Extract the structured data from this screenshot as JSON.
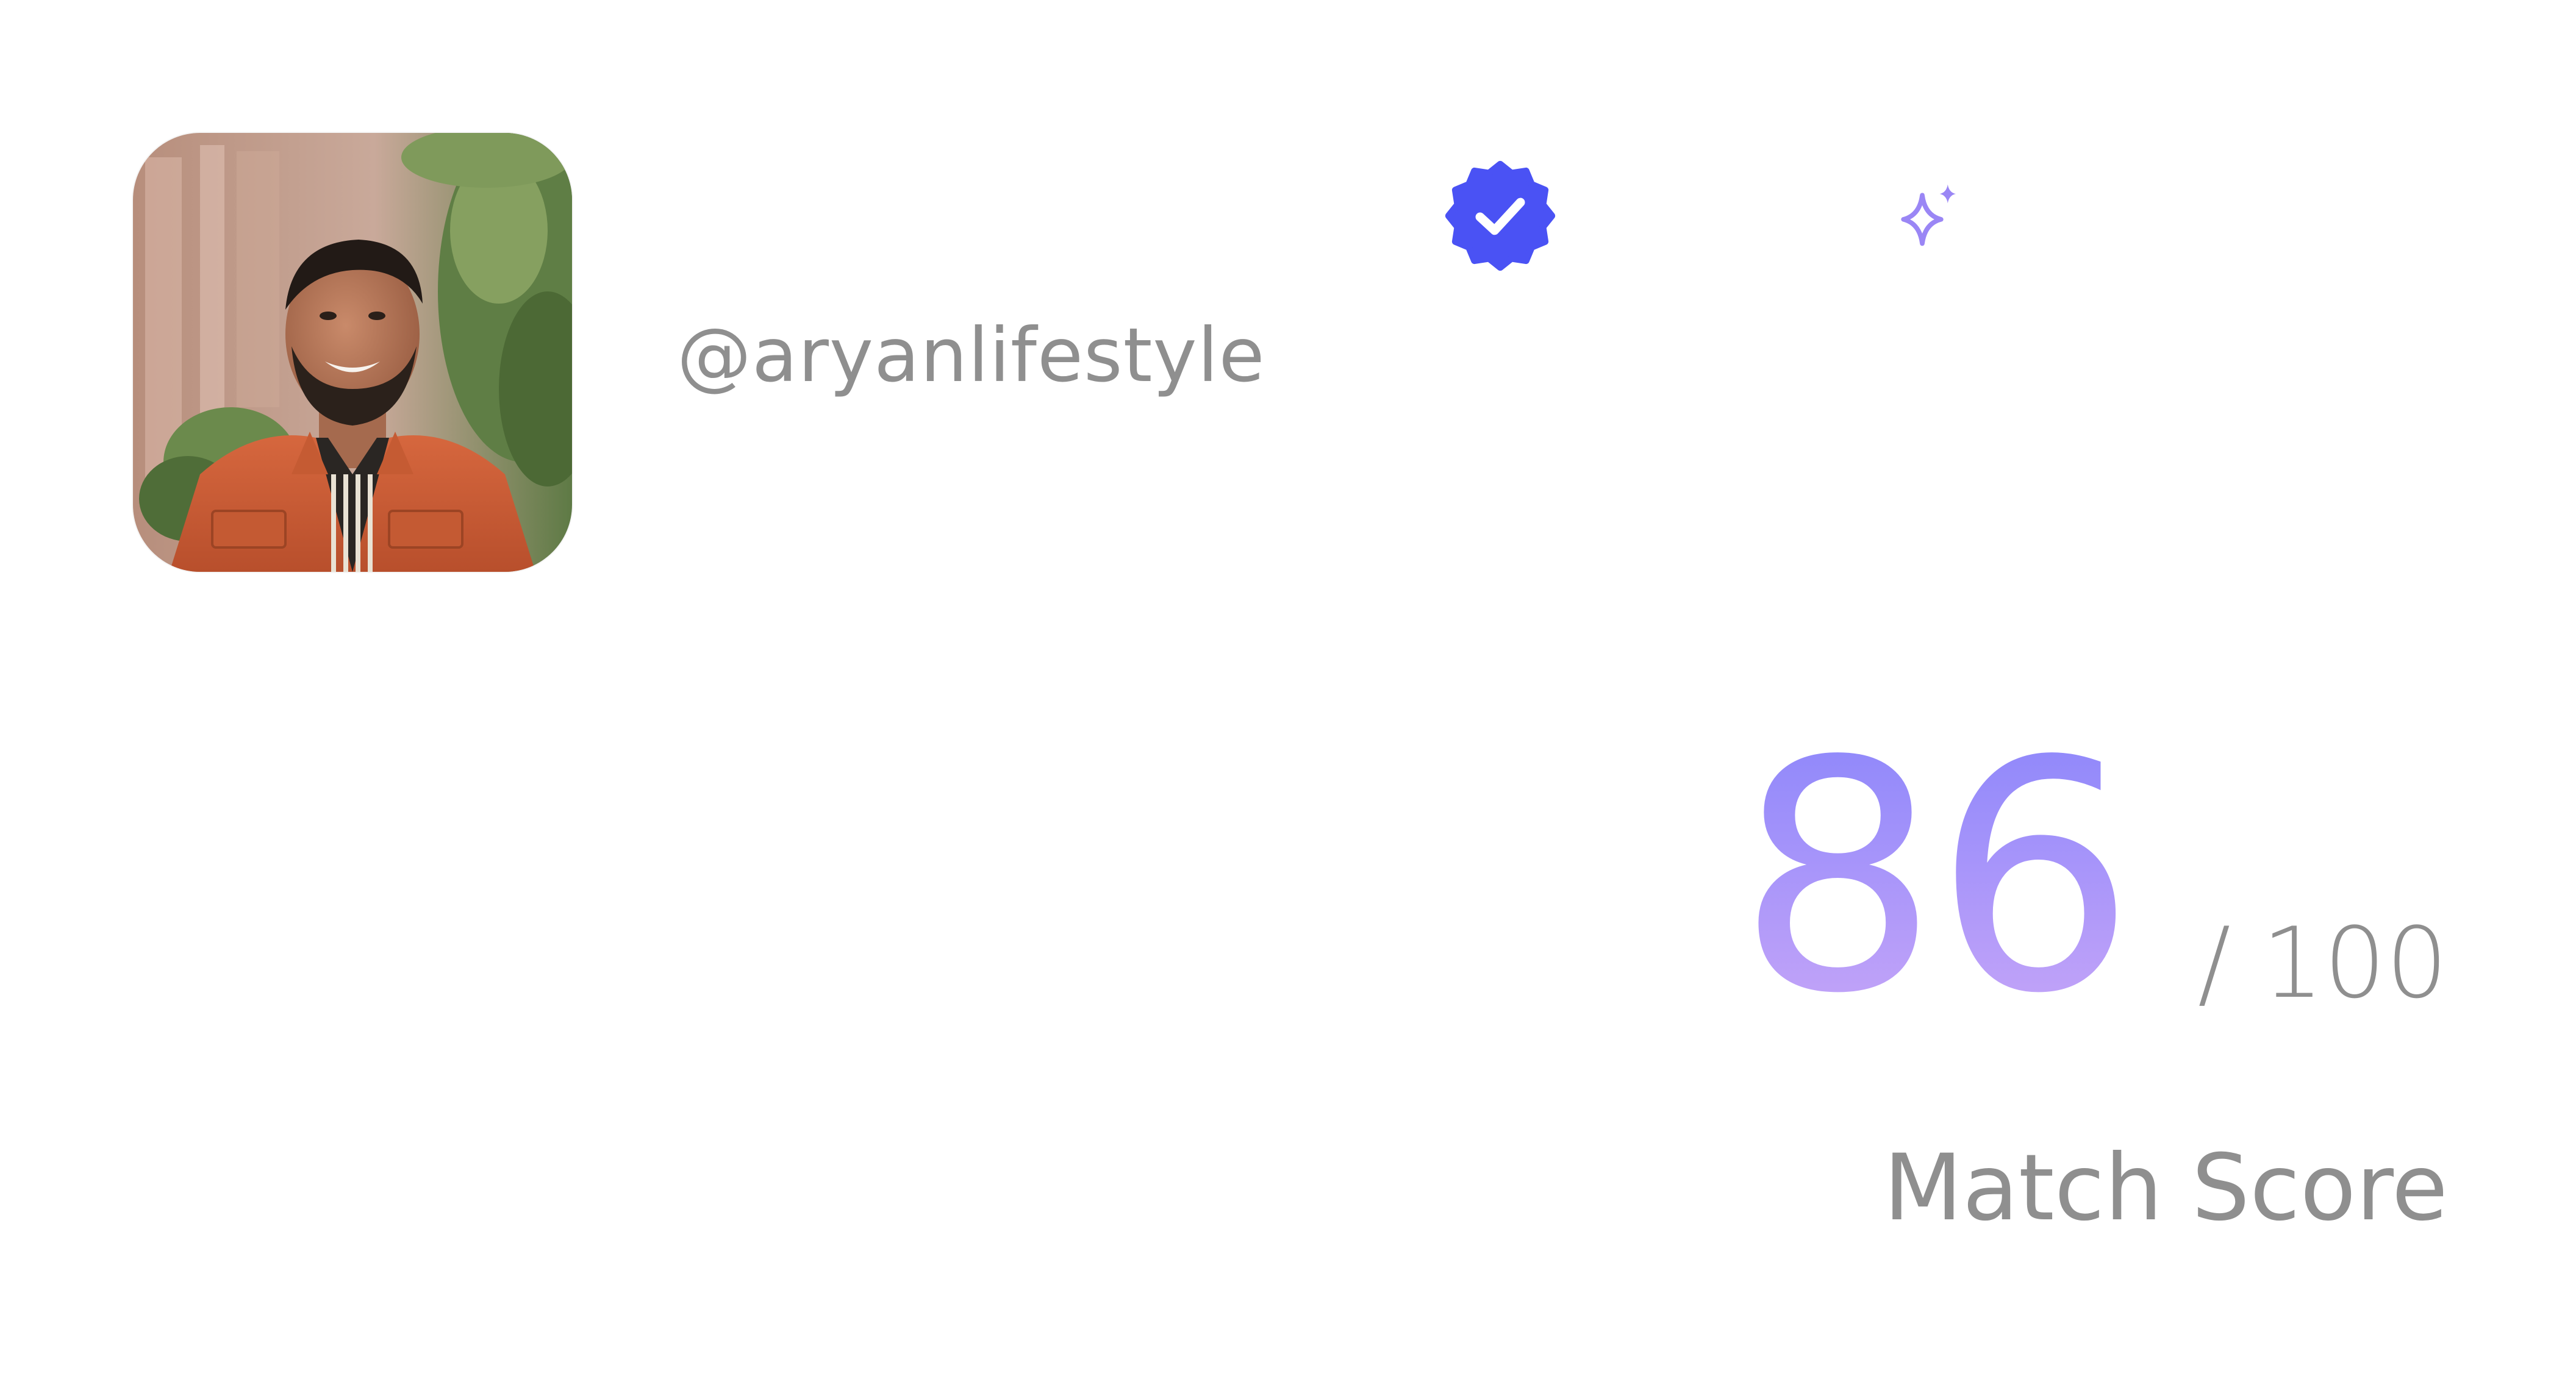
{
  "profile": {
    "handle": "@aryanlifestyle",
    "avatar_alt": "",
    "verified_icon": "verified-badge-icon",
    "sparkle_icon": "sparkle-icon"
  },
  "score": {
    "value": "86",
    "max": "/ 100",
    "label": "Match Score"
  },
  "colors": {
    "verified_badge": "#4a52f4",
    "sparkle": "#9a86f5",
    "score_gradient_top": "#8c86fb",
    "score_gradient_bottom": "#c7a6f8",
    "muted_text": "#8f8f8f"
  }
}
